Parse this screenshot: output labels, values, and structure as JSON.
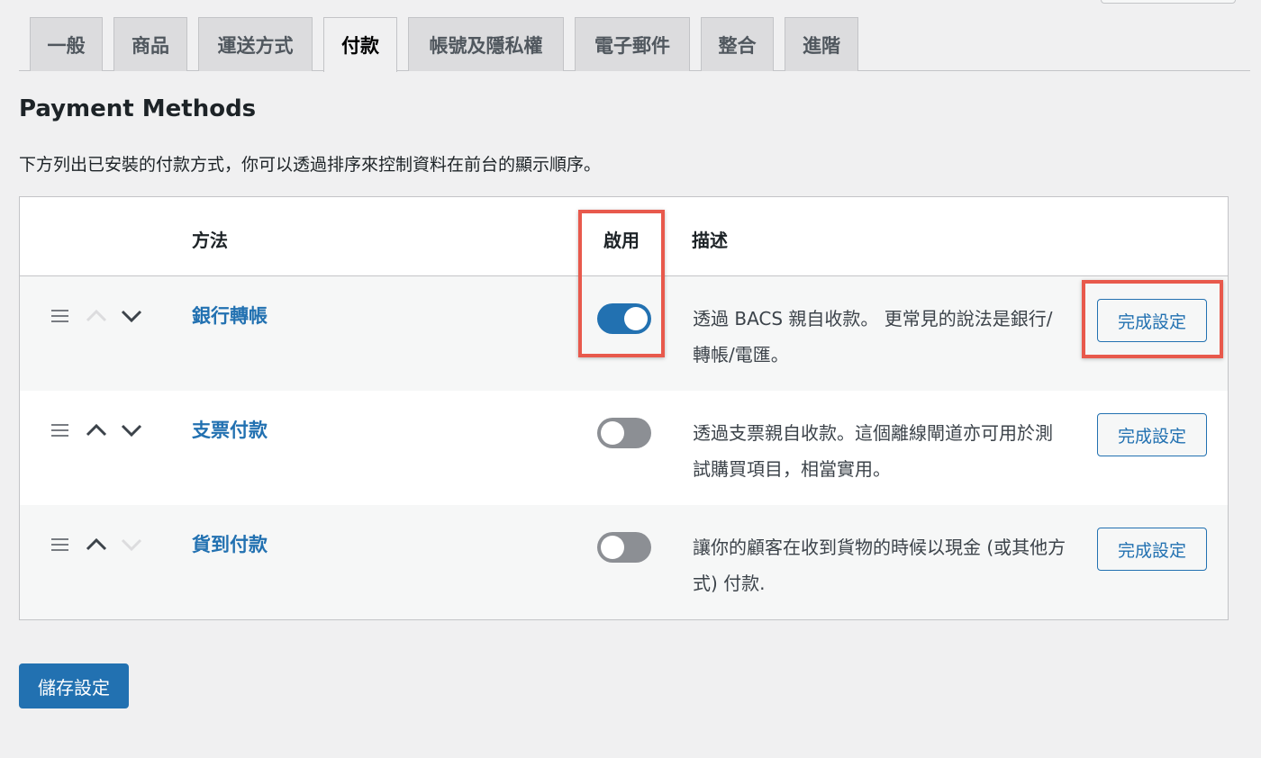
{
  "tabs": [
    {
      "label": "一般"
    },
    {
      "label": "商品"
    },
    {
      "label": "運送方式"
    },
    {
      "label": "付款"
    },
    {
      "label": "帳號及隱私權"
    },
    {
      "label": "電子郵件"
    },
    {
      "label": "整合"
    },
    {
      "label": "進階"
    }
  ],
  "active_tab": "付款",
  "page": {
    "title": "Payment Methods",
    "intro": "下方列出已安裝的付款方式，你可以透過排序來控制資料在前台的顯示順序。"
  },
  "table": {
    "headers": {
      "method": "方法",
      "enabled": "啟用",
      "description": "描述"
    },
    "rows": [
      {
        "name": "銀行轉帳",
        "enabled": true,
        "description": "透過 BACS 親自收款。 更常見的說法是銀行/轉帳/電匯。",
        "action": "完成設定",
        "up_enabled": false,
        "down_enabled": true
      },
      {
        "name": "支票付款",
        "enabled": false,
        "description": "透過支票親自收款。這個離線閘道亦可用於測試購買項目，相當實用。",
        "action": "完成設定",
        "up_enabled": true,
        "down_enabled": true
      },
      {
        "name": "貨到付款",
        "enabled": false,
        "description": "讓你的顧客在收到貨物的時候以現金 (或其他方式) 付款.",
        "action": "完成設定",
        "up_enabled": true,
        "down_enabled": false
      }
    ]
  },
  "save_button": "儲存設定",
  "colors": {
    "accent": "#2271b1",
    "highlight": "#e8594c",
    "toggle_off": "#8c8f94",
    "background": "#f0f0f1"
  },
  "icons": {
    "drag": "drag-handle-icon",
    "up": "chevron-up-icon",
    "down": "chevron-down-icon"
  }
}
